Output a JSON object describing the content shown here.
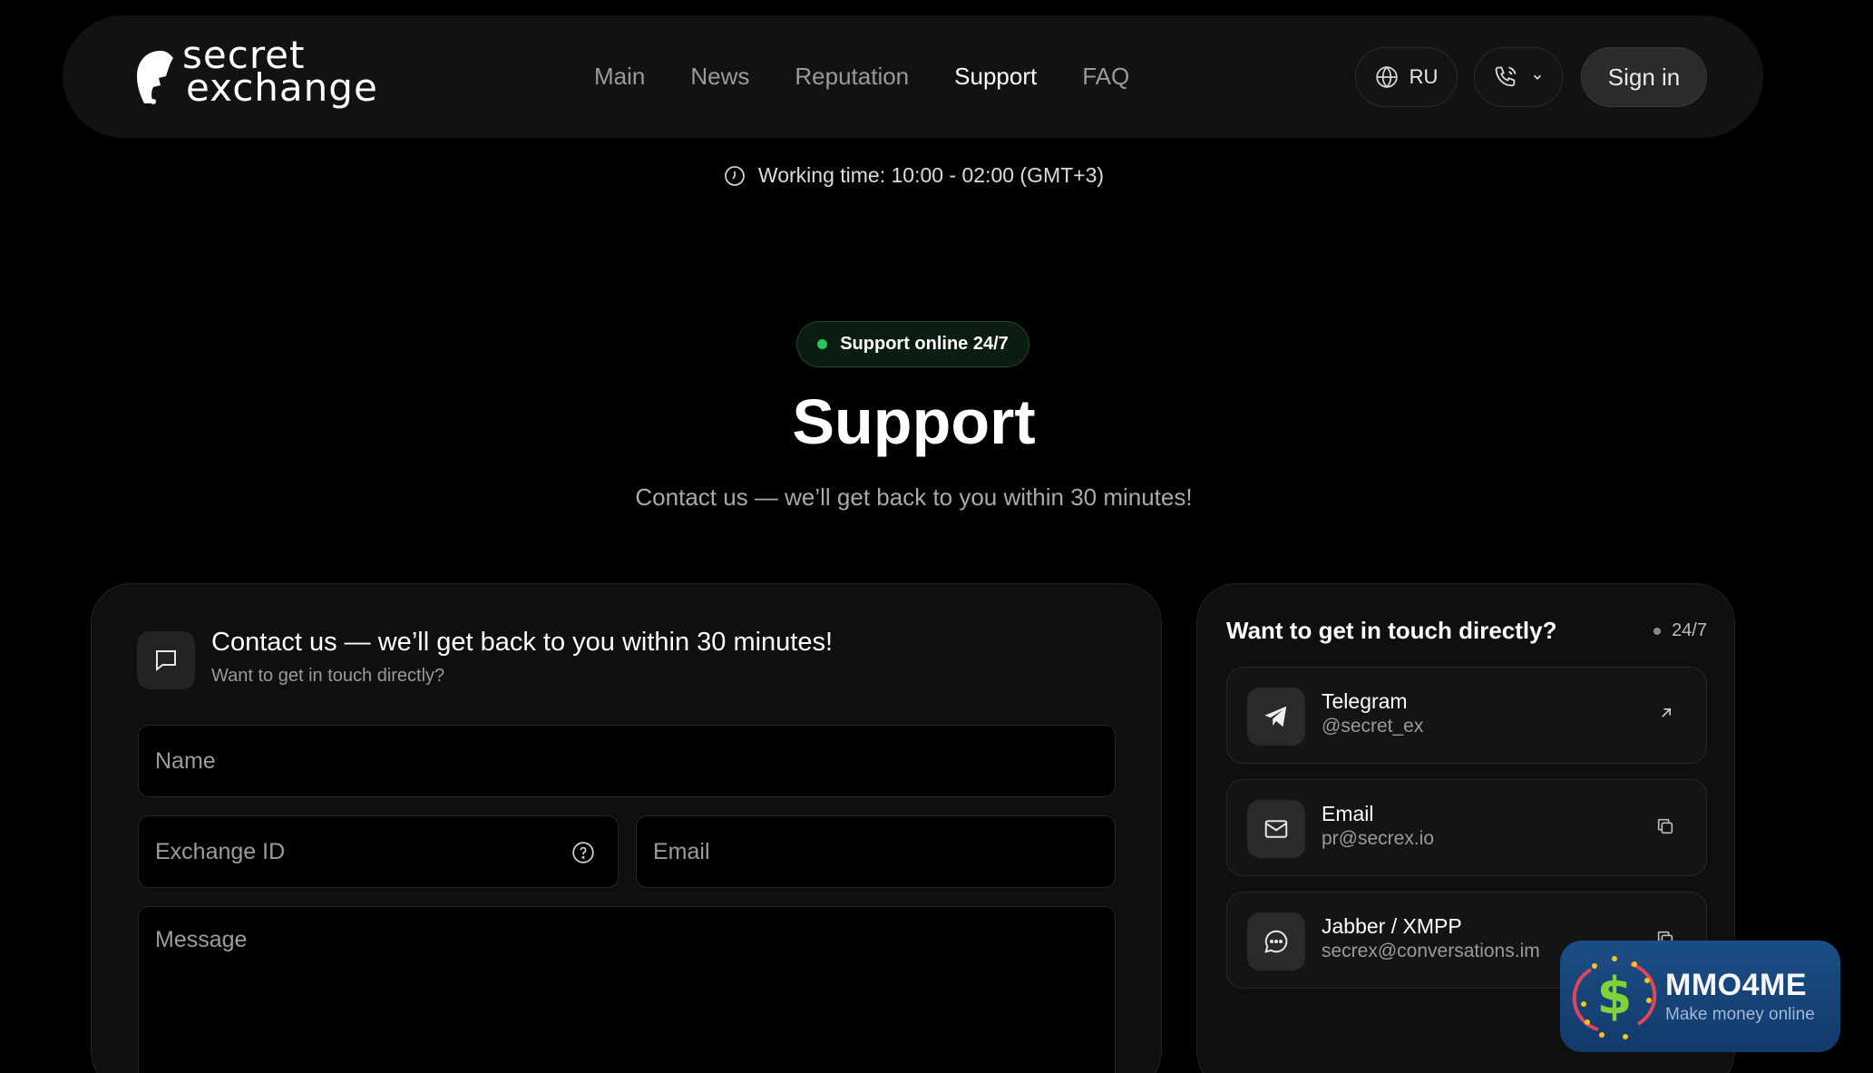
{
  "header": {
    "logo_line1": "secret",
    "logo_line2": "exchange",
    "nav": [
      {
        "label": "Main",
        "active": false
      },
      {
        "label": "News",
        "active": false
      },
      {
        "label": "Reputation",
        "active": false
      },
      {
        "label": "Support",
        "active": true
      },
      {
        "label": "FAQ",
        "active": false
      }
    ],
    "language": "RU",
    "sign_in": "Sign in"
  },
  "working_time": "Working time: 10:00 - 02:00 (GMT+3)",
  "hero": {
    "badge": "Support online 24/7",
    "title": "Support",
    "subtitle": "Contact us — we’ll get back to you within 30 minutes!"
  },
  "form": {
    "title": "Contact us — we’ll get back to you within 30 minutes!",
    "subtitle": "Want to get in touch directly?",
    "name_placeholder": "Name",
    "exchange_id_placeholder": "Exchange ID",
    "email_placeholder": "Email",
    "message_placeholder": "Message"
  },
  "direct": {
    "title": "Want to get in touch directly?",
    "badge": "24/7",
    "contacts": [
      {
        "title": "Telegram",
        "value": "@secret_ex",
        "icon": "telegram-icon",
        "action": "external-link-icon"
      },
      {
        "title": "Email",
        "value": "pr@secrex.io",
        "icon": "mail-icon",
        "action": "copy-icon"
      },
      {
        "title": "Jabber / XMPP",
        "value": "secrex@conversations.im",
        "icon": "chat-bubble-icon",
        "action": "copy-icon"
      }
    ]
  },
  "watermark": {
    "title": "MMO4ME",
    "subtitle": "Make money online"
  },
  "colors": {
    "background": "#000000",
    "card": "#0f0f0f",
    "online_green": "#22c55e",
    "watermark_blue": "#1b4e86"
  }
}
